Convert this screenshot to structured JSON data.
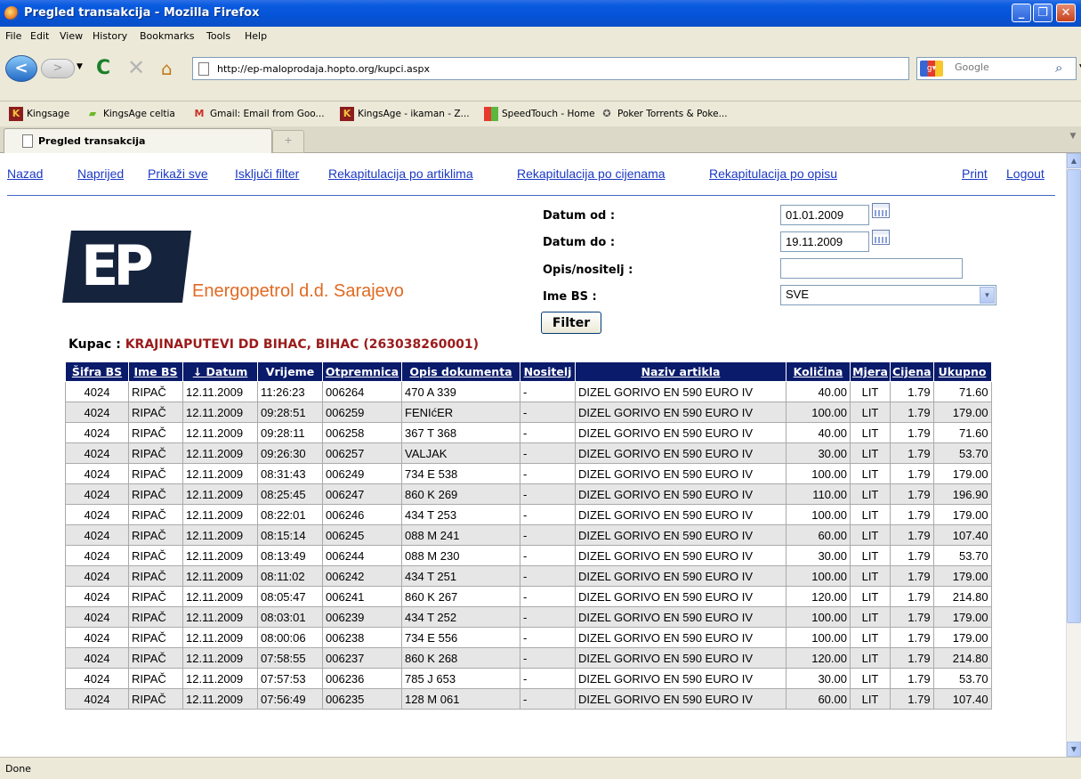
{
  "window": {
    "title": "Pregled transakcija - Mozilla Firefox"
  },
  "menu": [
    "File",
    "Edit",
    "View",
    "History",
    "Bookmarks",
    "Tools",
    "Help"
  ],
  "url": "http://ep-maloprodaja.hopto.org/kupci.aspx",
  "search_placeholder": "Google",
  "bookmarks": [
    "Kingsage",
    "KingsAge celtia",
    "Gmail: Email from Goo...",
    "KingsAge - ikaman - Z...",
    "SpeedTouch - Home",
    "Poker Torrents & Poke..."
  ],
  "tab": {
    "label": "Pregled transakcija"
  },
  "nav_links": [
    "Nazad",
    "Naprijed",
    "Prikaži sve",
    "Isključi filter",
    "Rekapitulacija po artiklima",
    "Rekapitulacija po cijenama",
    "Rekapitulacija po opisu",
    "Print",
    "Logout"
  ],
  "logo_text": "EP",
  "company": "Energopetrol d.d. Sarajevo",
  "filter": {
    "datum_od_label": "Datum od :",
    "datum_od": "01.01.2009",
    "datum_do_label": "Datum do :",
    "datum_do": "19.11.2009",
    "opis_label": "Opis/nositelj :",
    "opis": "",
    "ime_bs_label": "Ime BS :",
    "ime_bs": "SVE",
    "button": "Filter"
  },
  "kupac": {
    "label": "Kupac :",
    "value": "KRAJINAPUTEVI DD BIHAC, BIHAC (263038260001)"
  },
  "table": {
    "headers": [
      "Šifra BS",
      "Ime BS",
      "↓ Datum",
      "Vrijeme",
      "Otpremnica",
      "Opis dokumenta",
      "Nositelj",
      "Naziv artikla",
      "Količina",
      "Mjera",
      "Cijena",
      "Ukupno"
    ],
    "rows": [
      [
        "4024",
        "RIPAČ",
        "12.11.2009",
        "11:26:23",
        "006264",
        "470 A 339",
        "-",
        "DIZEL GORIVO EN 590 EURO IV",
        "40.00",
        "LIT",
        "1.79",
        "71.60"
      ],
      [
        "4024",
        "RIPAČ",
        "12.11.2009",
        "09:28:51",
        "006259",
        "FENIćER",
        "-",
        "DIZEL GORIVO EN 590 EURO IV",
        "100.00",
        "LIT",
        "1.79",
        "179.00"
      ],
      [
        "4024",
        "RIPAČ",
        "12.11.2009",
        "09:28:11",
        "006258",
        "367 T 368",
        "-",
        "DIZEL GORIVO EN 590 EURO IV",
        "40.00",
        "LIT",
        "1.79",
        "71.60"
      ],
      [
        "4024",
        "RIPAČ",
        "12.11.2009",
        "09:26:30",
        "006257",
        "VALJAK",
        "-",
        "DIZEL GORIVO EN 590 EURO IV",
        "30.00",
        "LIT",
        "1.79",
        "53.70"
      ],
      [
        "4024",
        "RIPAČ",
        "12.11.2009",
        "08:31:43",
        "006249",
        "734 E 538",
        "-",
        "DIZEL GORIVO EN 590 EURO IV",
        "100.00",
        "LIT",
        "1.79",
        "179.00"
      ],
      [
        "4024",
        "RIPAČ",
        "12.11.2009",
        "08:25:45",
        "006247",
        "860 K 269",
        "-",
        "DIZEL GORIVO EN 590 EURO IV",
        "110.00",
        "LIT",
        "1.79",
        "196.90"
      ],
      [
        "4024",
        "RIPAČ",
        "12.11.2009",
        "08:22:01",
        "006246",
        "434 T 253",
        "-",
        "DIZEL GORIVO EN 590 EURO IV",
        "100.00",
        "LIT",
        "1.79",
        "179.00"
      ],
      [
        "4024",
        "RIPAČ",
        "12.11.2009",
        "08:15:14",
        "006245",
        "088 M 241",
        "-",
        "DIZEL GORIVO EN 590 EURO IV",
        "60.00",
        "LIT",
        "1.79",
        "107.40"
      ],
      [
        "4024",
        "RIPAČ",
        "12.11.2009",
        "08:13:49",
        "006244",
        "088 M 230",
        "-",
        "DIZEL GORIVO EN 590 EURO IV",
        "30.00",
        "LIT",
        "1.79",
        "53.70"
      ],
      [
        "4024",
        "RIPAČ",
        "12.11.2009",
        "08:11:02",
        "006242",
        "434 T 251",
        "-",
        "DIZEL GORIVO EN 590 EURO IV",
        "100.00",
        "LIT",
        "1.79",
        "179.00"
      ],
      [
        "4024",
        "RIPAČ",
        "12.11.2009",
        "08:05:47",
        "006241",
        "860 K 267",
        "-",
        "DIZEL GORIVO EN 590 EURO IV",
        "120.00",
        "LIT",
        "1.79",
        "214.80"
      ],
      [
        "4024",
        "RIPAČ",
        "12.11.2009",
        "08:03:01",
        "006239",
        "434 T 252",
        "-",
        "DIZEL GORIVO EN 590 EURO IV",
        "100.00",
        "LIT",
        "1.79",
        "179.00"
      ],
      [
        "4024",
        "RIPAČ",
        "12.11.2009",
        "08:00:06",
        "006238",
        "734 E 556",
        "-",
        "DIZEL GORIVO EN 590 EURO IV",
        "100.00",
        "LIT",
        "1.79",
        "179.00"
      ],
      [
        "4024",
        "RIPAČ",
        "12.11.2009",
        "07:58:55",
        "006237",
        "860 K 268",
        "-",
        "DIZEL GORIVO EN 590 EURO IV",
        "120.00",
        "LIT",
        "1.79",
        "214.80"
      ],
      [
        "4024",
        "RIPAČ",
        "12.11.2009",
        "07:57:53",
        "006236",
        "785 J 653",
        "-",
        "DIZEL GORIVO EN 590 EURO IV",
        "30.00",
        "LIT",
        "1.79",
        "53.70"
      ],
      [
        "4024",
        "RIPAČ",
        "12.11.2009",
        "07:56:49",
        "006235",
        "128 M 061",
        "-",
        "DIZEL GORIVO EN 590 EURO IV",
        "60.00",
        "LIT",
        "1.79",
        "107.40"
      ]
    ]
  },
  "status": "Done"
}
